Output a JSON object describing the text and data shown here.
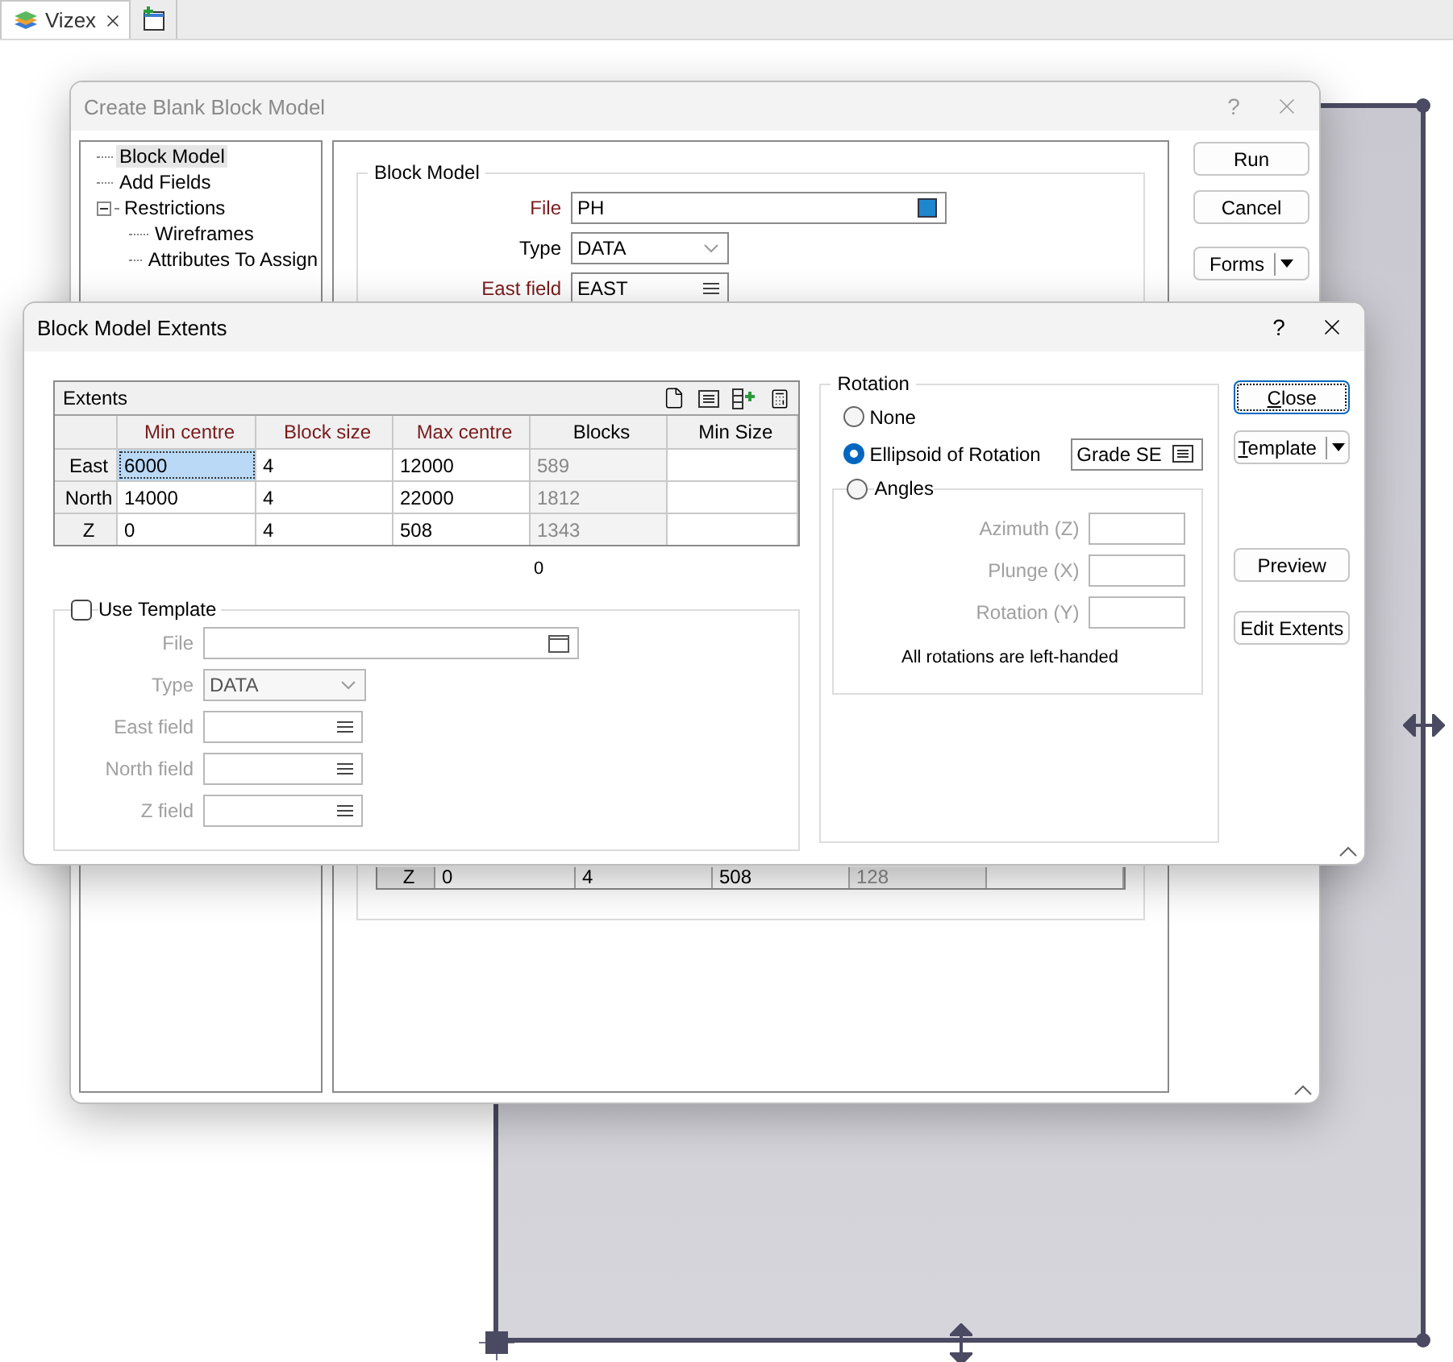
{
  "app_tabs": [
    {
      "label": "Vizex",
      "selected": true
    }
  ],
  "create_dialog": {
    "title": "Create Blank Block Model",
    "help": "?",
    "tree": [
      {
        "label": "Block Model",
        "selected": true
      },
      {
        "label": "Add Fields",
        "selected": false
      },
      {
        "label": "Restrictions",
        "selected": false,
        "expanded": true,
        "children": [
          {
            "label": "Wireframes",
            "selected": false
          },
          {
            "label": "Attributes To Assign",
            "selected": false
          }
        ]
      }
    ],
    "group_title": "Block Model",
    "fields": [
      {
        "kind": "file_linked",
        "label": "File",
        "value": "PH",
        "required": true
      },
      {
        "kind": "dropdown",
        "label": "Type",
        "value": "DATA",
        "required": false
      },
      {
        "kind": "list",
        "label": "East field",
        "value": "EAST",
        "required": true
      }
    ],
    "table_row": {
      "label": "Z",
      "cells": [
        {
          "text": "0",
          "readonly": false
        },
        {
          "text": "4",
          "readonly": false
        },
        {
          "text": "508",
          "readonly": false
        },
        {
          "text": "128",
          "readonly": true
        }
      ]
    },
    "buttons": [
      {
        "kind": "plain",
        "label": "Run"
      },
      {
        "kind": "plain",
        "label": "Cancel"
      },
      {
        "kind": "split",
        "label": "Forms"
      }
    ]
  },
  "extents_dialog": {
    "title": "Block Model Extents",
    "help": "?",
    "extents": {
      "title": "Extents",
      "columns": [
        {
          "label": "Min centre",
          "required": true,
          "readonly": false
        },
        {
          "label": "Block size",
          "required": true,
          "readonly": false
        },
        {
          "label": "Max centre",
          "required": true,
          "readonly": false
        },
        {
          "label": "Blocks",
          "required": false,
          "readonly": true
        },
        {
          "label": "Min Size",
          "required": false,
          "readonly": false
        }
      ],
      "rows": [
        {
          "label": "East",
          "cells": [
            {
              "text": "6000",
              "selected": true
            },
            {
              "text": "4",
              "selected": false
            },
            {
              "text": "12000",
              "selected": false
            },
            {
              "text": "589",
              "selected": false
            }
          ]
        },
        {
          "label": "North",
          "cells": [
            {
              "text": "14000",
              "selected": false
            },
            {
              "text": "4",
              "selected": false
            },
            {
              "text": "22000",
              "selected": false
            },
            {
              "text": "1812",
              "selected": false
            }
          ]
        },
        {
          "label": "Z",
          "cells": [
            {
              "text": "0",
              "selected": false
            },
            {
              "text": "4",
              "selected": false
            },
            {
              "text": "508",
              "selected": false
            },
            {
              "text": "1343",
              "selected": false
            }
          ]
        }
      ]
    },
    "total": "0",
    "template": {
      "label": "Use Template",
      "checked": false,
      "fields": [
        {
          "kind": "file",
          "label": "File"
        },
        {
          "kind": "dropdown",
          "label": "Type",
          "value": "DATA"
        },
        {
          "kind": "list",
          "label": "East field"
        },
        {
          "kind": "list",
          "label": "North field"
        },
        {
          "kind": "list",
          "label": "Z field"
        }
      ]
    },
    "rotation": {
      "title": "Rotation",
      "options": [
        {
          "label": "None",
          "selected": false
        },
        {
          "label": "Ellipsoid of Rotation",
          "selected": true,
          "value": "Grade SE"
        },
        {
          "label": "Angles",
          "selected": false
        }
      ],
      "angle_fields": [
        {
          "label": "Azimuth (Z)"
        },
        {
          "label": "Plunge (X)"
        },
        {
          "label": "Rotation (Y)"
        }
      ],
      "note": "All rotations are left-handed"
    },
    "buttons": [
      {
        "kind": "plain",
        "label": "Close",
        "focused": true,
        "mnemonic": true
      },
      {
        "kind": "split",
        "label": "Template",
        "focused": false,
        "mnemonic": true
      },
      {
        "kind": "plain",
        "label": "Preview",
        "focused": false,
        "mnemonic": false
      },
      {
        "kind": "plain",
        "label": "Edit Extents",
        "focused": false,
        "mnemonic": false
      }
    ]
  }
}
